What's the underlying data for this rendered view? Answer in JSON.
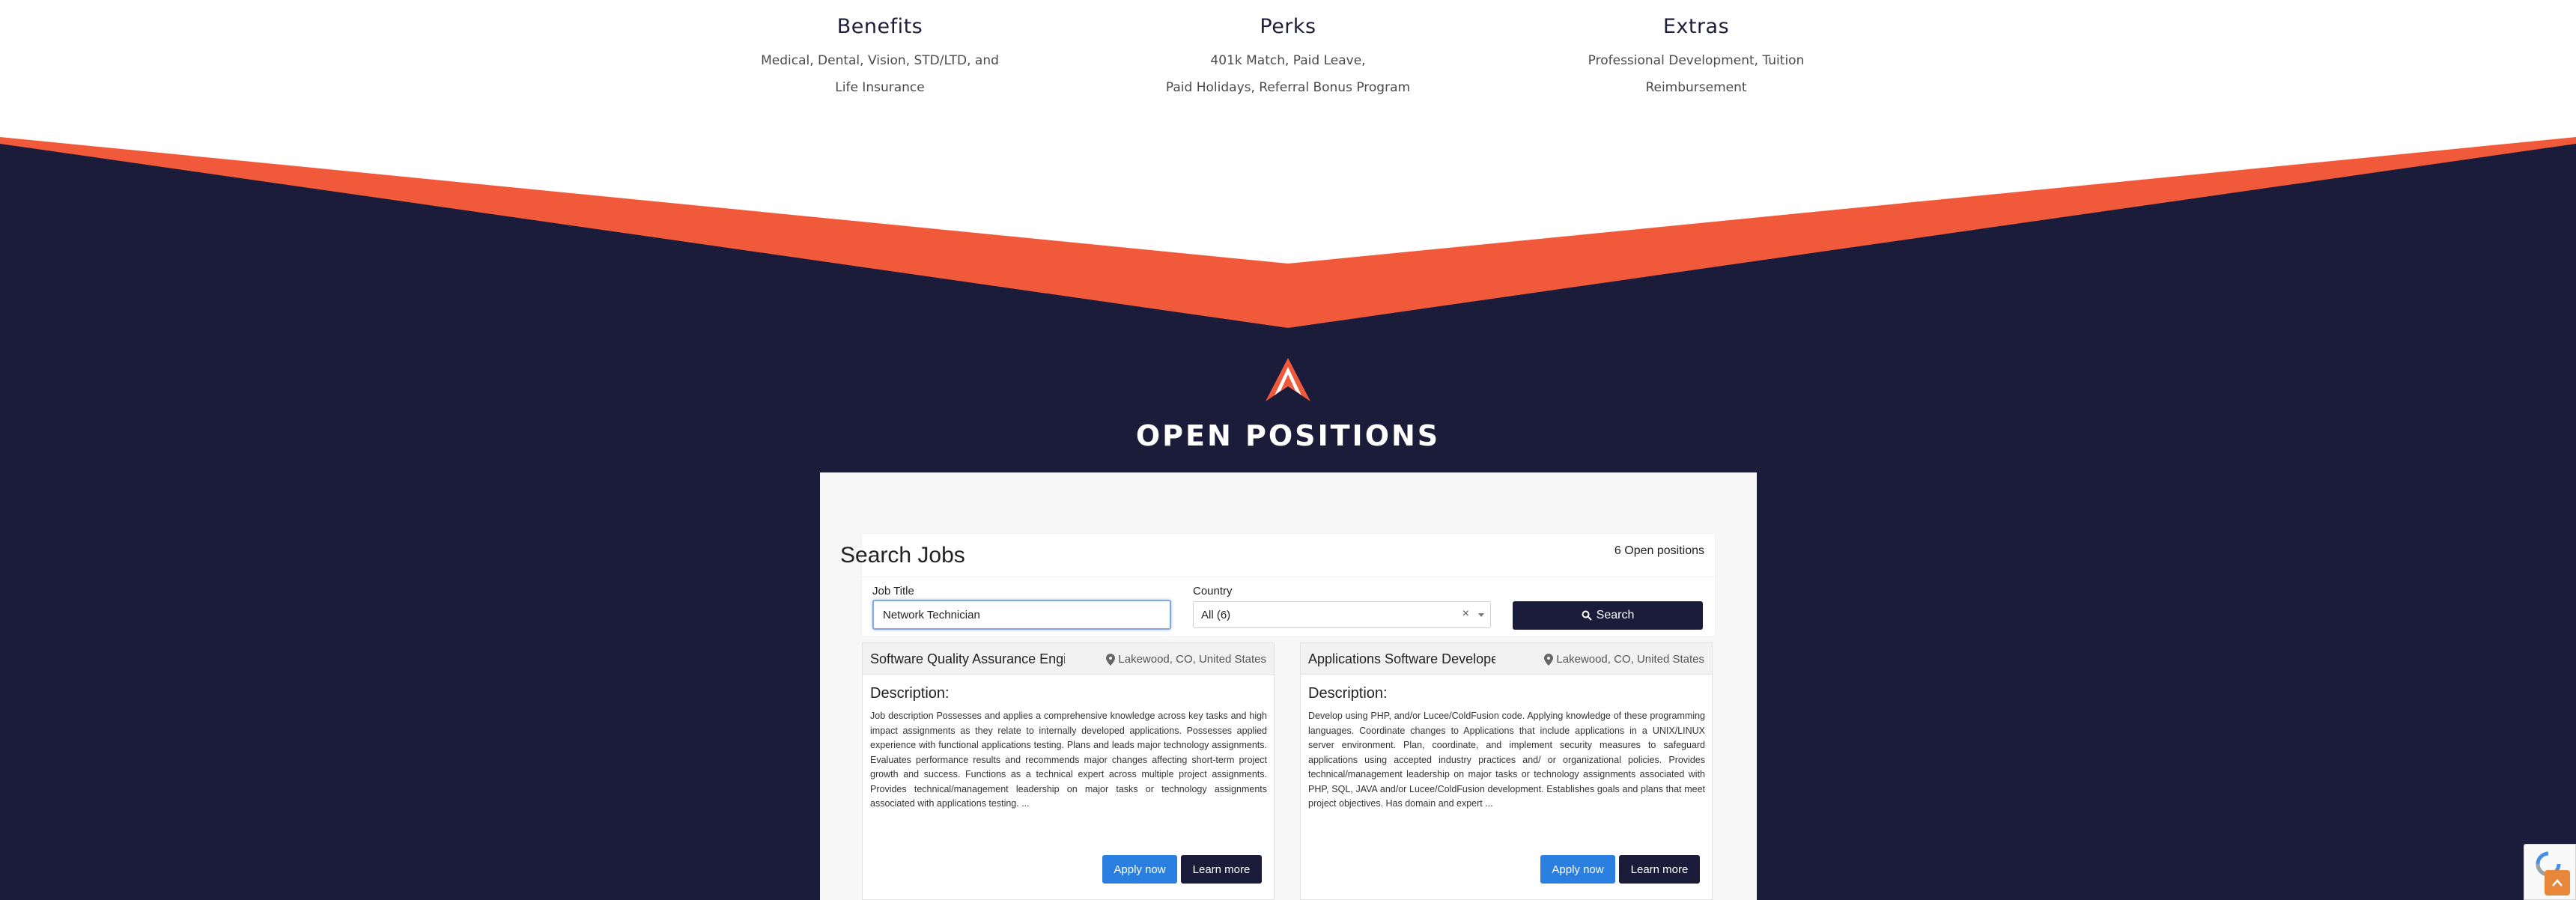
{
  "benefits": [
    {
      "title": "Benefits",
      "line1": "Medical, Dental, Vision, STD/LTD, and",
      "line2": "Life Insurance"
    },
    {
      "title": "Perks",
      "line1": "401k Match, Paid Leave,",
      "line2": "Paid Holidays, Referral Bonus Program"
    },
    {
      "title": "Extras",
      "line1": "Professional Development, Tuition",
      "line2": "Reimbursement"
    }
  ],
  "section": {
    "title": "OPEN POSITIONS"
  },
  "search": {
    "title": "Search Jobs",
    "count": "6 Open positions",
    "job_title_label": "Job Title",
    "job_title_value": "Network Technician",
    "country_label": "Country",
    "country_value": "All (6)",
    "clear": "×",
    "button_label": "Search"
  },
  "jobs": [
    {
      "title": "Software Quality Assurance Engineer",
      "location": "Lakewood, CO, United States",
      "desc_heading": "Description:",
      "description": "Job description Possesses and applies a comprehensive knowledge across key tasks and high impact assignments as they relate to internally developed applications. Possesses applied experience with functional applications testing. Plans and leads major technology assignments. Evaluates performance results and recommends major changes affecting short-term project growth and success. Functions as a technical expert across multiple project assignments. Provides technical/management leadership on major tasks or technology assignments associated with applications testing. ...",
      "apply": "Apply now",
      "learn": "Learn more"
    },
    {
      "title": "Applications Software Developer",
      "location": "Lakewood, CO, United States",
      "desc_heading": "Description:",
      "description": "Develop using PHP, and/or Lucee/ColdFusion code. Applying knowledge of these programming languages. Coordinate changes to Applications that include applications in a UNIX/LINUX server environment. Plan, coordinate, and implement security measures to safeguard applications using accepted industry practices and/ or organizational policies. Provides technical/management leadership on major tasks or technology assignments associated with PHP, SQL, JAVA and/or Lucee/ColdFusion development. Establishes goals and plans that meet project objectives. Has domain and expert ...",
      "apply": "Apply now",
      "learn": "Learn more"
    }
  ],
  "colors": {
    "navy": "#1b1b3a",
    "orange": "#f05a3a",
    "blue": "#2a7fe0"
  },
  "icons": [
    "search-icon",
    "location-pin-icon",
    "chevron-up-icon",
    "recaptcha-icon",
    "company-logo-icon"
  ]
}
